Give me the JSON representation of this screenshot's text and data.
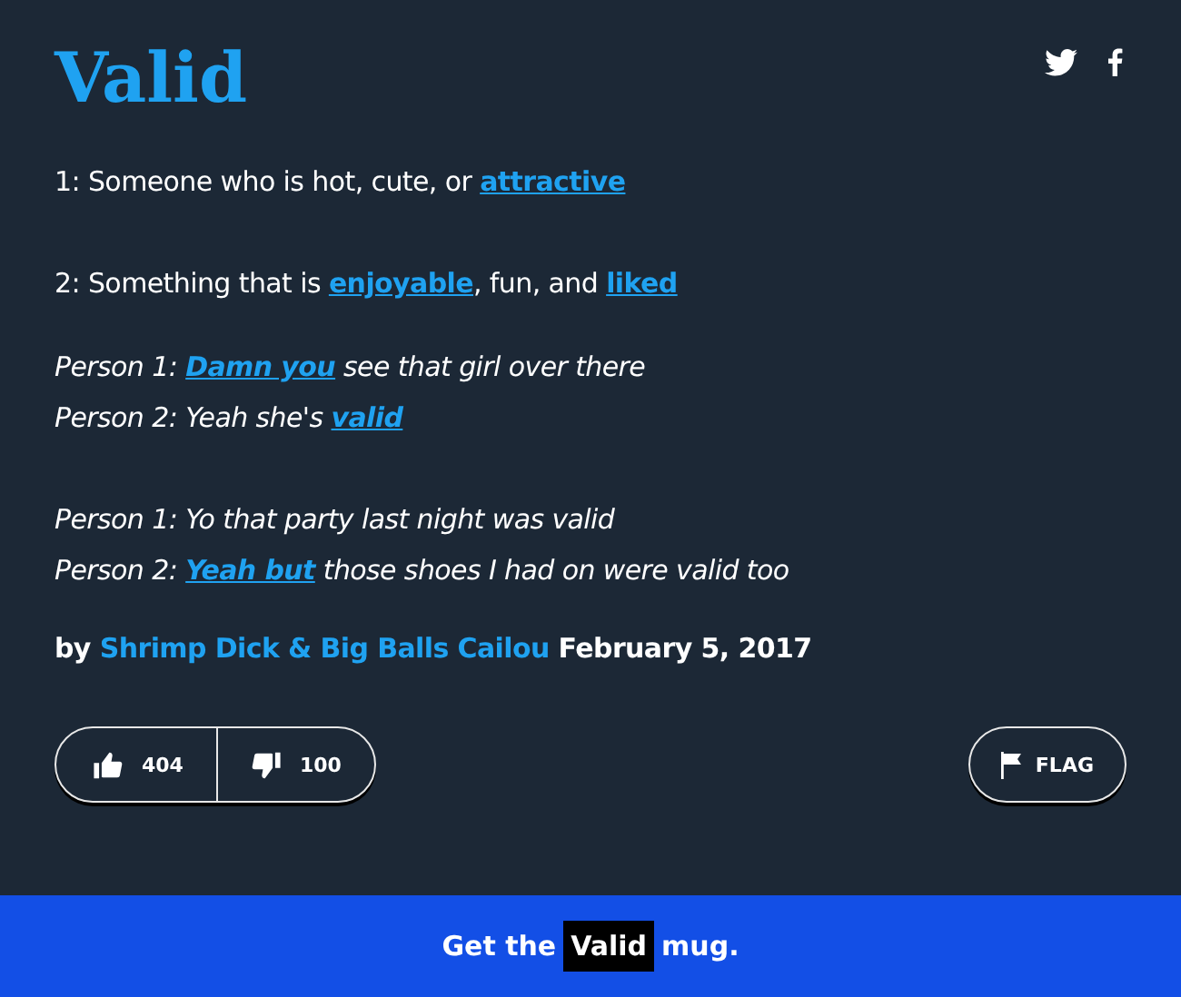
{
  "title": "Valid",
  "share": [
    {
      "kind": "twitter"
    },
    {
      "kind": "facebook"
    }
  ],
  "definitions": [
    {
      "parts": [
        {
          "kind": "text",
          "text": "1: Someone who is hot, cute, or "
        },
        {
          "kind": "link",
          "text": "attractive"
        }
      ]
    },
    {
      "parts": [
        {
          "kind": "text",
          "text": "2: Something that is "
        },
        {
          "kind": "link",
          "text": "enjoyable"
        },
        {
          "kind": "text",
          "text": ", fun, and "
        },
        {
          "kind": "link",
          "text": "liked"
        }
      ]
    }
  ],
  "examples": [
    [
      {
        "parts": [
          {
            "kind": "text",
            "text": "Person 1: "
          },
          {
            "kind": "link",
            "text": "Damn you"
          },
          {
            "kind": "text",
            "text": " see that girl over there"
          }
        ]
      },
      {
        "parts": [
          {
            "kind": "text",
            "text": "Person 2: Yeah she's "
          },
          {
            "kind": "link",
            "text": "valid"
          }
        ]
      }
    ],
    [
      {
        "parts": [
          {
            "kind": "text",
            "text": "Person 1: Yo that party last night was valid"
          }
        ]
      },
      {
        "parts": [
          {
            "kind": "text",
            "text": "Person 2: "
          },
          {
            "kind": "link",
            "text": "Yeah but"
          },
          {
            "kind": "text",
            "text": " those shoes I had on were valid too"
          }
        ]
      }
    ]
  ],
  "byline": {
    "prefix": "by",
    "author": "Shrimp Dick & Big Balls Cailou",
    "date": "February 5, 2017"
  },
  "votes": {
    "up": "404",
    "down": "100"
  },
  "flag": "FLAG",
  "banner": {
    "before": "Get the",
    "highlight": "Valid",
    "after": "mug."
  }
}
